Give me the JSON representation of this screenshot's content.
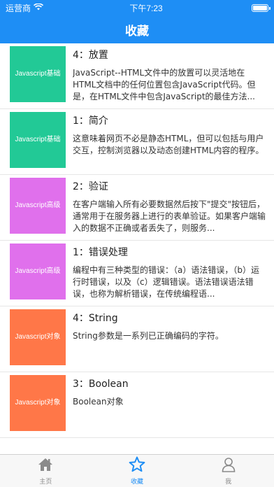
{
  "status_bar": {
    "carrier": "运营商",
    "time": "下午7:23"
  },
  "nav": {
    "title": "收藏"
  },
  "items": [
    {
      "category": "Javascript基础",
      "color": "#22c996",
      "title": "4：放置",
      "desc": "JavaScript--HTML文件中的放置可以灵活地在HTML文档中的任何位置包含JavaScript代码。但是，在HTML文件中包含JavaScript的最佳方法..."
    },
    {
      "category": "Javascript基础",
      "color": "#22c996",
      "title": "1：简介",
      "desc": "这意味着网页不必是静态HTML，但可以包括与用户交互，控制浏览器以及动态创建HTML内容的程序。"
    },
    {
      "category": "Javascript高级",
      "color": "#e070ec",
      "title": "2：验证",
      "desc": "在客户端输入所有必要数据然后按下\"提交\"按钮后，通常用于在服务器上进行的表单验证。如果客户端输入的数据不正确或者丢失了，则服务..."
    },
    {
      "category": "Javascript高级",
      "color": "#e070ec",
      "title": "1：错误处理",
      "desc": "编程中有三种类型的错误：（a）语法错误，（b）运行时错误，以及（c）逻辑错误。语法错误语法错误，也称为解析错误，在传统编程语..."
    },
    {
      "category": "Javascript对象",
      "color": "#ff7748",
      "title": "4：String",
      "desc": "String参数是一系列已正确编码的字符。"
    },
    {
      "category": "Javascript对象",
      "color": "#ff7748",
      "title": "3：Boolean",
      "desc": "Boolean对象"
    }
  ],
  "tabs": [
    {
      "label": "主页",
      "icon": "home-icon",
      "active": false
    },
    {
      "label": "收藏",
      "icon": "star-icon",
      "active": true
    },
    {
      "label": "我",
      "icon": "person-icon",
      "active": false
    }
  ],
  "colors": {
    "accent": "#1e8ef5",
    "inactive_tab": "#8a8a8a"
  }
}
